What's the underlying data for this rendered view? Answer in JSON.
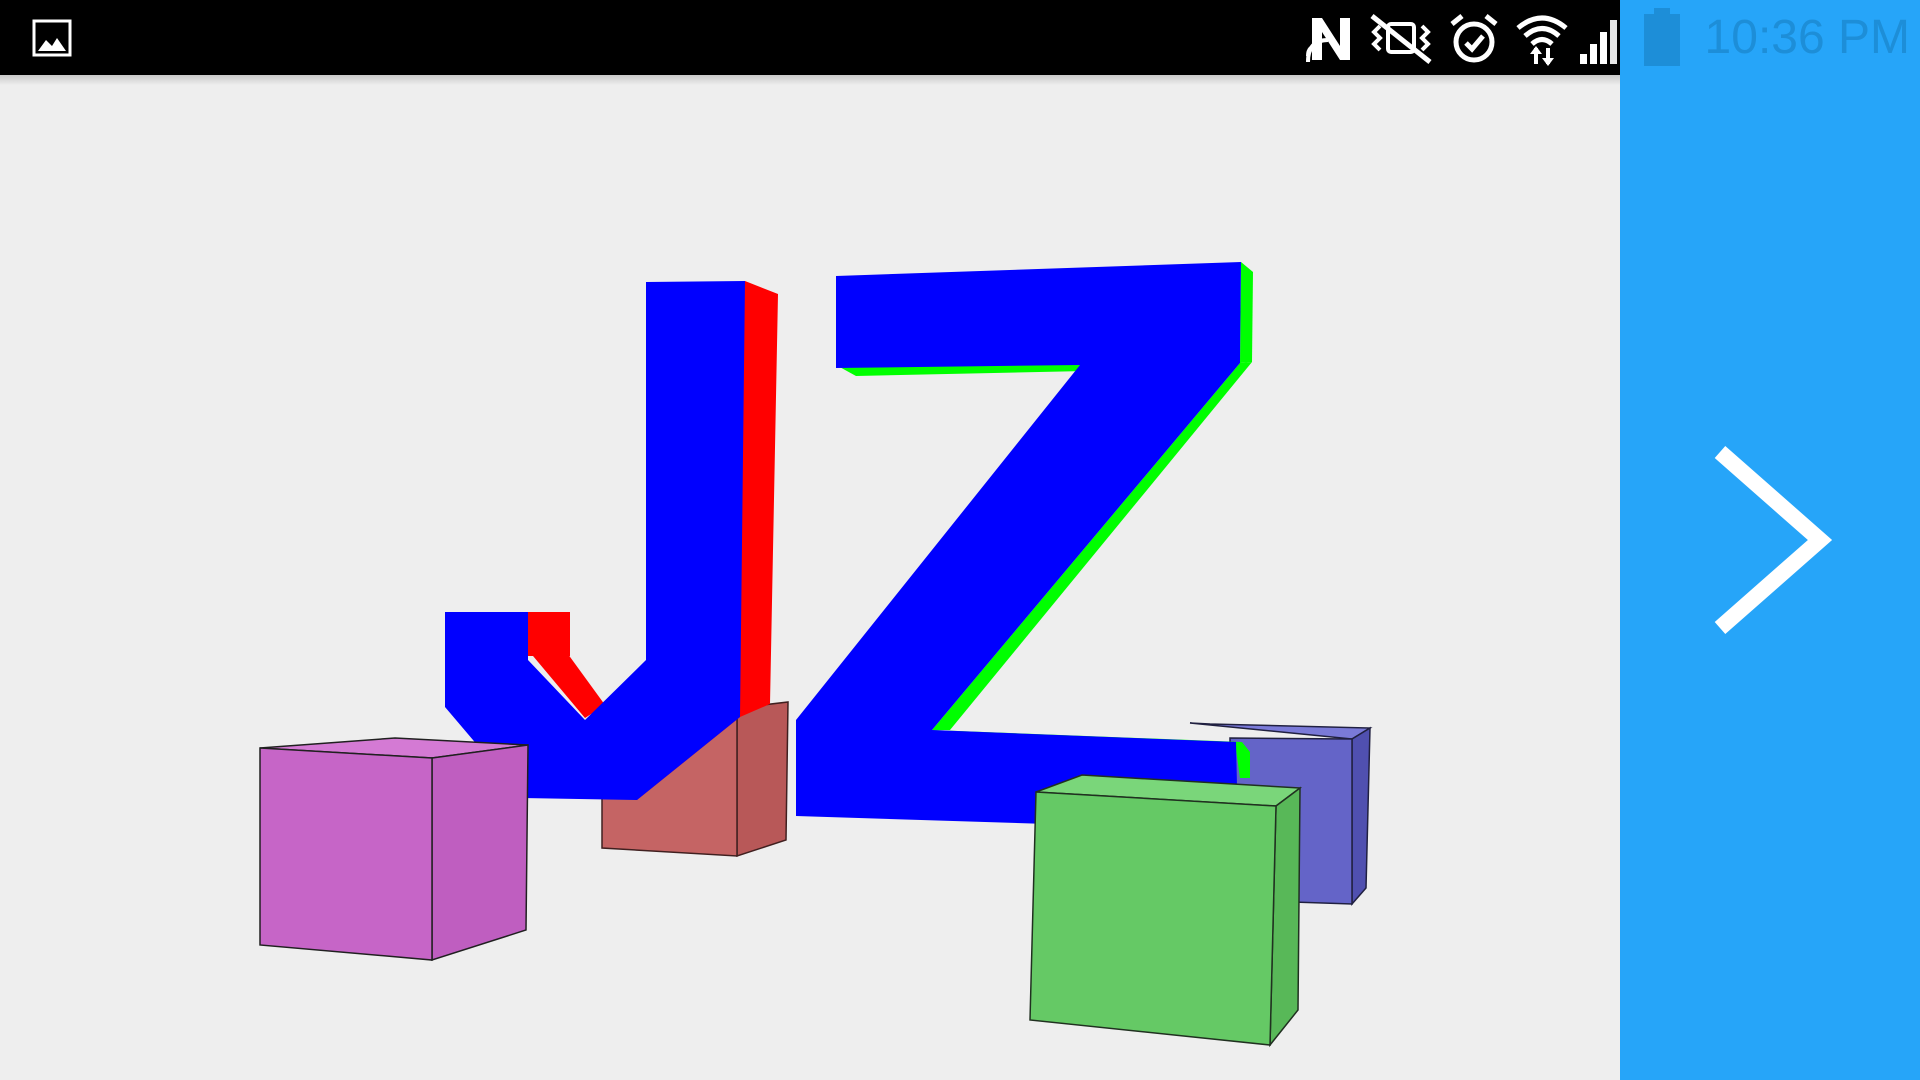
{
  "status_bar": {
    "time": "10:36 PM",
    "icons": [
      "gallery-notification-icon",
      "nfc-n-icon",
      "vibrate-mute-icon",
      "alarm-clock-icon",
      "wifi-data-icon",
      "cell-signal-icon",
      "battery-icon"
    ]
  },
  "scene": {
    "letters": [
      "J",
      "Z"
    ],
    "colors": {
      "background": "#eeeeee",
      "letter_front": "#0000ff",
      "j_side": "#ff0000",
      "z_side": "#00ff00",
      "cube_magenta": "#c665c7",
      "cube_red": "#c56464",
      "cube_green": "#65c965",
      "cube_blue": "#6464c8"
    }
  },
  "side_panel": {
    "color": "#26a5f9",
    "next_icon": "chevron-right-icon"
  }
}
